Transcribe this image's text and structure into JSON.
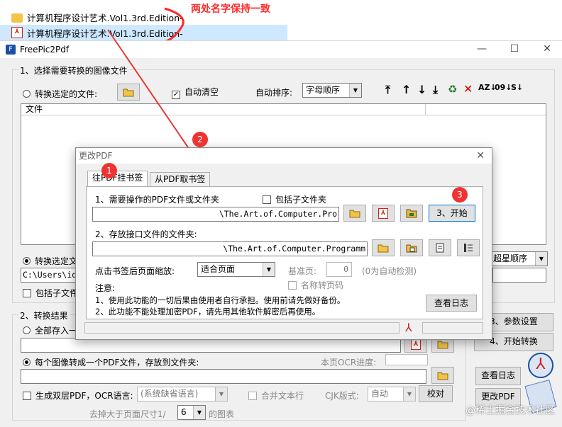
{
  "explorer": {
    "files": [
      {
        "name": "计算机程序设计艺术.Vol1.3rd.Edition-",
        "type": "folder",
        "icon": "folder-icon"
      },
      {
        "name": "计算机程序设计艺术.Vol1.3rd.Edition-",
        "type": "pdf",
        "icon": "pdf-file-icon"
      }
    ],
    "note": "两处名字保持一致"
  },
  "window": {
    "title": "FreePic2Pdf"
  },
  "section1": {
    "label": "1、选择需要转换的图像文件",
    "convert_selected": "转换选定的文件:",
    "auto_clear": "自动清空",
    "auto_sort": "自动排序:",
    "sort_value": "字母顺序",
    "col_file": "文件",
    "convert_selected2": "转换选定文",
    "path_prefix": "C:\\Users\\id",
    "include_sub": "包括子文件",
    "sort2_value": "超星顺序"
  },
  "section2": {
    "label": "2、转换结果",
    "save_all": "全部存入一",
    "per_image": "每个图像转成一个PDF文件，存放到文件夹:",
    "ocr_progress": "本页OCR进度:",
    "dual_layer": "生成双层PDF，OCR语言:",
    "ocr_lang": "(系统缺省语言)",
    "merge_lines": "合并文本行",
    "cjk_label": "CJK版式:",
    "cjk_value": "自动",
    "proof": "校对",
    "remove_label": "去掉大于页面尺寸1/",
    "remove_value": "6",
    "remove_suffix": "的图表"
  },
  "right_buttons": {
    "params": "3、参数设置",
    "start": "4、开始转换",
    "view_log": "查看日志",
    "modify_pdf": "更改PDF"
  },
  "dialog": {
    "title": "更改PDF",
    "tabs": [
      "往PDF挂书签",
      "从PDF取书签"
    ],
    "step1": "1、需要操作的PDF文件或文件夹",
    "include_sub": "包括子文件夹",
    "path1": "\\The.Art.of.Computer.Pro",
    "start_button": "3、开始",
    "step2": "2、存放接口文件的文件夹:",
    "path2": "\\The.Art.of.Computer.Programm",
    "zoom_label": "点击书签后页面缩放:",
    "zoom_value": "适合页面",
    "base_page_label": "基准页:",
    "base_page_value": "0",
    "auto_detect": "(0为自动检测)",
    "name_page": "名称转页码",
    "notice_label": "注意:",
    "notice1": "1、使用此功能的一切后果由使用者自行承担。使用前请先做好备份。",
    "notice2": "2、此功能不能处理加密PDF，请先用其他软件解密后再使用。",
    "view_log": "查看日志"
  },
  "markers": [
    "1",
    "2",
    "3"
  ],
  "watermark": "@稀土掘金技术社区",
  "colors": {
    "accent": "#0078d7",
    "annotation": "#ff2a2a"
  }
}
